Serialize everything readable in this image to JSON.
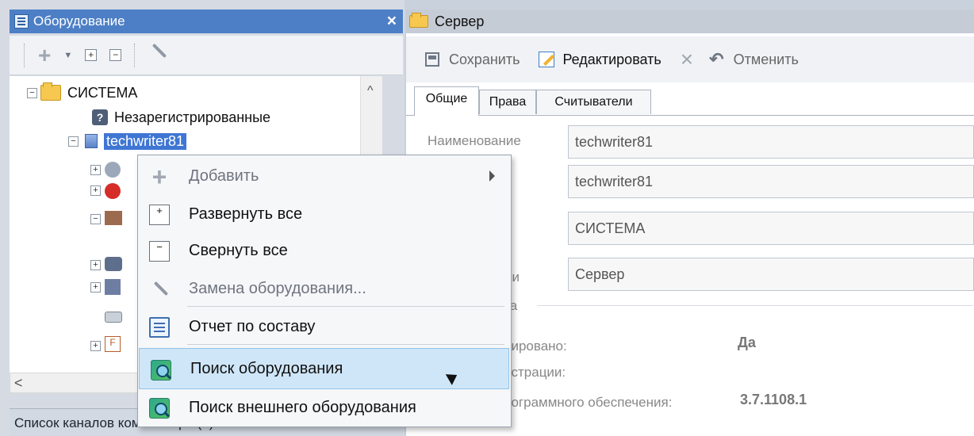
{
  "left_panel": {
    "title": "Оборудование",
    "tree": {
      "root": "СИСТЕМА",
      "unregistered": "Незарегистрированные",
      "server": "techwriter81"
    },
    "bottom_tab": "Список каналов компьютера (0)"
  },
  "right_panel": {
    "title": "Сервер",
    "toolbar": {
      "save": "Сохранить",
      "edit": "Редактировать",
      "cancel": "Отменить"
    },
    "tabs": [
      "Общие",
      "Права",
      "Считыватели"
    ],
    "fields": {
      "name_label": "Наименование",
      "name_value": "techwriter81",
      "host_value": "techwriter81",
      "system_value": "СИСТЕМА",
      "type_label_fragment": "ии",
      "type_value": "Сервер"
    },
    "status": {
      "group_fragment": "ка",
      "registered_label_fragment": "рировано:",
      "registered_value": "Да",
      "registration_label_fragment": "истрации:",
      "software_label_fragment": "рограммного обеспечения:",
      "software_value": "3.7.1108.1"
    }
  },
  "context_menu": {
    "items": [
      {
        "label": "Добавить",
        "icon": "plus-icon",
        "enabled": false,
        "has_submenu": true
      },
      {
        "label": "Развернуть все",
        "icon": "expand-all-icon",
        "enabled": true
      },
      {
        "label": "Свернуть все",
        "icon": "collapse-all-icon",
        "enabled": true
      },
      {
        "label": "Замена оборудования...",
        "icon": "wrench-icon",
        "enabled": false
      },
      {
        "label": "Отчет по составу",
        "icon": "report-icon",
        "enabled": true
      },
      {
        "label": "Поиск оборудования",
        "icon": "search-equipment-icon",
        "enabled": true,
        "highlighted": true
      },
      {
        "label": "Поиск внешнего оборудования",
        "icon": "search-external-equipment-icon",
        "enabled": true
      }
    ]
  },
  "colors": {
    "title_blue": "#4d7fc6",
    "selection_blue": "#3f76d3",
    "menu_highlight": "#cfe6f8"
  }
}
